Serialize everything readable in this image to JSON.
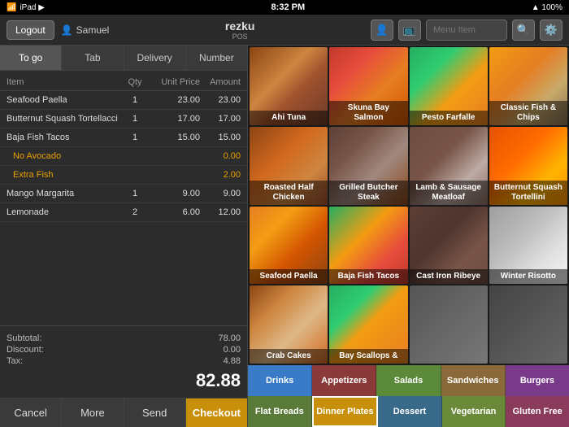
{
  "statusBar": {
    "left": "iPad ▶",
    "time": "8:32 PM",
    "right": "▲ 100%"
  },
  "header": {
    "logoutLabel": "Logout",
    "userName": "Samuel",
    "brand": "rezku",
    "brandSub": "POS",
    "searchPlaceholder": "Menu Item"
  },
  "orderTabs": [
    {
      "id": "to-go",
      "label": "To go"
    },
    {
      "id": "tab",
      "label": "Tab"
    },
    {
      "id": "delivery",
      "label": "Delivery"
    },
    {
      "id": "number",
      "label": "Number"
    }
  ],
  "orderTableHeaders": {
    "item": "Item",
    "qty": "Qty",
    "unitPrice": "Unit Price",
    "amount": "Amount"
  },
  "orderItems": [
    {
      "id": 1,
      "name": "Seafood Paella",
      "qty": "1",
      "price": "23.00",
      "amount": "23.00",
      "type": "item"
    },
    {
      "id": 2,
      "name": "Butternut Squash Tortellacci",
      "qty": "1",
      "price": "17.00",
      "amount": "17.00",
      "type": "item"
    },
    {
      "id": 3,
      "name": "Baja Fish Tacos",
      "qty": "1",
      "price": "15.00",
      "amount": "15.00",
      "type": "item"
    },
    {
      "id": 4,
      "name": "No Avocado",
      "qty": "",
      "price": "",
      "amount": "0.00",
      "type": "modifier"
    },
    {
      "id": 5,
      "name": "Extra Fish",
      "qty": "",
      "price": "",
      "amount": "2.00",
      "type": "modifier"
    },
    {
      "id": 6,
      "name": "Mango Margarita",
      "qty": "1",
      "price": "9.00",
      "amount": "9.00",
      "type": "item"
    },
    {
      "id": 7,
      "name": "Lemonade",
      "qty": "2",
      "price": "6.00",
      "amount": "12.00",
      "type": "item"
    }
  ],
  "totals": {
    "subtotalLabel": "Subtotal:",
    "subtotalValue": "78.00",
    "discountLabel": "Discount:",
    "discountValue": "0.00",
    "taxLabel": "Tax:",
    "taxValue": "4.88",
    "grandTotal": "82.88"
  },
  "actionButtons": [
    {
      "id": "cancel",
      "label": "Cancel"
    },
    {
      "id": "more",
      "label": "More"
    },
    {
      "id": "send",
      "label": "Send"
    },
    {
      "id": "checkout",
      "label": "Checkout",
      "style": "checkout"
    }
  ],
  "menuItems": [
    {
      "id": 1,
      "name": "Ahi Tuna",
      "foodClass": "food-ahi-tuna"
    },
    {
      "id": 2,
      "name": "Skuna Bay Salmon",
      "foodClass": "food-skuna-bay"
    },
    {
      "id": 3,
      "name": "Pesto Farfalle",
      "foodClass": "food-pesto-farfalle"
    },
    {
      "id": 4,
      "name": "Classic Fish & Chips",
      "foodClass": "food-classic-fish"
    },
    {
      "id": 5,
      "name": "Roasted Half Chicken",
      "foodClass": "food-roasted-chicken"
    },
    {
      "id": 6,
      "name": "Grilled Butcher Steak",
      "foodClass": "food-grilled-steak"
    },
    {
      "id": 7,
      "name": "Lamb & Sausage Meatloaf",
      "foodClass": "food-lamb-sausage"
    },
    {
      "id": 8,
      "name": "Butternut Squash Tortellini",
      "foodClass": "food-butternut"
    },
    {
      "id": 9,
      "name": "Seafood Paella",
      "foodClass": "food-seafood-paella"
    },
    {
      "id": 10,
      "name": "Baja Fish Tacos",
      "foodClass": "food-baja-fish"
    },
    {
      "id": 11,
      "name": "Cast Iron Ribeye",
      "foodClass": "food-cast-iron"
    },
    {
      "id": 12,
      "name": "Winter Risotto",
      "foodClass": "food-winter-risotto"
    },
    {
      "id": 13,
      "name": "Crab Cakes",
      "foodClass": "food-crab-cakes"
    },
    {
      "id": 14,
      "name": "Bay Scallops &",
      "foodClass": "food-bay-scallops"
    },
    {
      "id": 15,
      "name": "",
      "foodClass": "food-placeholder1"
    },
    {
      "id": 16,
      "name": "",
      "foodClass": "food-placeholder2"
    }
  ],
  "categoryTabs1": [
    {
      "id": "drinks",
      "label": "Drinks",
      "cssClass": "cat-drinks"
    },
    {
      "id": "appetizers",
      "label": "Appetizers",
      "cssClass": "cat-appetizers"
    },
    {
      "id": "salads",
      "label": "Salads",
      "cssClass": "cat-salads"
    },
    {
      "id": "sandwiches",
      "label": "Sandwiches",
      "cssClass": "cat-sandwiches"
    },
    {
      "id": "burgers",
      "label": "Burgers",
      "cssClass": "cat-burgers"
    }
  ],
  "categoryTabs2": [
    {
      "id": "flat-breads",
      "label": "Flat Breads",
      "cssClass": "cat-flatbreads"
    },
    {
      "id": "dinner-plates",
      "label": "Dinner Plates",
      "cssClass": "cat-dinnerplates",
      "active": true
    },
    {
      "id": "dessert",
      "label": "Dessert",
      "cssClass": "cat-dessert"
    },
    {
      "id": "vegetarian",
      "label": "Vegetarian",
      "cssClass": "cat-vegetarian"
    },
    {
      "id": "gluten-free",
      "label": "Gluten Free",
      "cssClass": "cat-glutenfree"
    }
  ]
}
